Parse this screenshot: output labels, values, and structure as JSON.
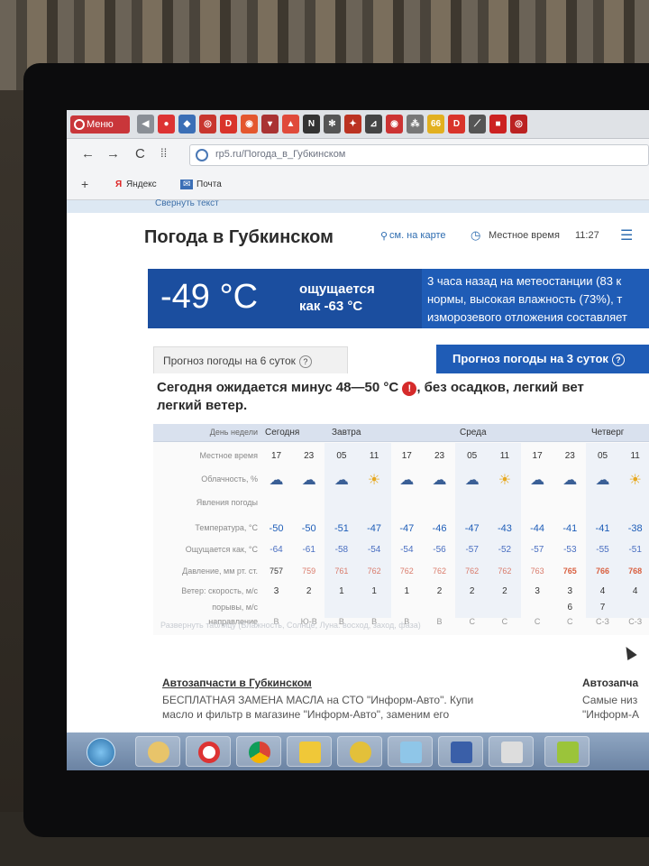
{
  "browser": {
    "menu_label": "Меню",
    "url": "rp5.ru/Погода_в_Губкинском",
    "bookmarks": [
      "Яндекс",
      "Почта"
    ]
  },
  "page": {
    "collapse_link": "Свернуть текст",
    "title": "Погода в Губкинском",
    "map_link": "см. на карте",
    "local_time_label": "Местное время",
    "local_time": "11:27",
    "current_temp": "-49 °C",
    "feels_like_line1": "ощущается",
    "feels_like_line2": "как -63 °C",
    "station_note": [
      "3 часа назад на метеостанции (83 к",
      "нормы, высокая влажность (73%), т",
      "изморозевого отложения составляет"
    ],
    "tab_6days": "Прогноз погоды на 6 суток",
    "tab_3days": "Прогноз погоды на 3 суток",
    "expect_line1": "Сегодня ожидается минус 48—50 °C",
    "expect_line1b": ", без осадков, легкий вет",
    "expect_line2": "легкий ветер.",
    "expand_table": "Развернуть таблицу (Влажность, Солнце, Луна: восход, заход, фаза)"
  },
  "forecast": {
    "row_labels": {
      "day": "День недели",
      "time": "Местное время",
      "cloud": "Облачность, %",
      "phen": "Явления погоды",
      "temp": "Температура, °С",
      "feels": "Ощущается как, °С",
      "pressure": "Давление, мм рт. ст.",
      "wind_speed": "Ветер: скорость, м/с",
      "gusts": "порывы, м/с",
      "direction": "направление"
    },
    "days": [
      "Сегодня",
      "Завтра",
      "Среда",
      "Четверг"
    ],
    "hours": [
      "17",
      "23",
      "05",
      "11",
      "17",
      "23",
      "05",
      "11",
      "17",
      "23",
      "05",
      "11"
    ],
    "icons": [
      "☁",
      "☁",
      "☁",
      "☀",
      "☁",
      "☁",
      "☁",
      "☀",
      "☁",
      "☁",
      "☁",
      "☀"
    ],
    "temps": [
      "-50",
      "-50",
      "-51",
      "-47",
      "-47",
      "-46",
      "-47",
      "-43",
      "-44",
      "-41",
      "-41",
      "-38"
    ],
    "feels": [
      "-64",
      "-61",
      "-58",
      "-54",
      "-54",
      "-56",
      "-57",
      "-52",
      "-57",
      "-53",
      "-55",
      "-51"
    ],
    "pressure": [
      "757",
      "759",
      "761",
      "762",
      "762",
      "762",
      "762",
      "762",
      "763",
      "765",
      "766",
      "768"
    ],
    "wind": [
      "3",
      "2",
      "1",
      "1",
      "1",
      "2",
      "2",
      "2",
      "3",
      "3",
      "4",
      "4"
    ],
    "gusts": [
      "",
      "",
      "",
      "",
      "",
      "",
      "",
      "",
      "",
      "6",
      "7",
      ""
    ],
    "direction": [
      "В",
      "Ю-В",
      "В",
      "В",
      "В",
      "В",
      "С",
      "С",
      "С",
      "С",
      "С-З",
      "С-З"
    ]
  },
  "ads": {
    "left_title": "Автозапчасти в Губкинском",
    "left_text": [
      "БЕСПЛАТНАЯ ЗАМЕНА МАСЛА на СТО \"Информ-Авто\". Купи",
      "масло и фильтр в магазине \"Информ-Авто\", заменим его"
    ],
    "right_title": "Автозапча",
    "right_text": [
      "Самые низ",
      "\"Информ-А"
    ]
  }
}
